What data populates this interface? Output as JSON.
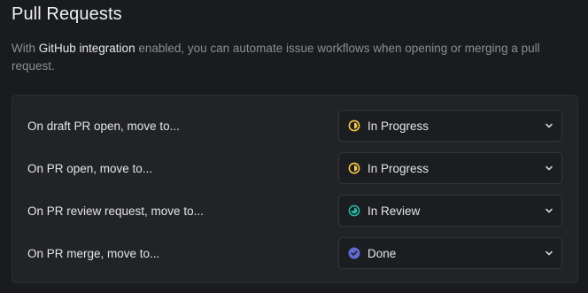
{
  "header": {
    "title": "Pull Requests",
    "desc_prefix": "With ",
    "desc_link": "GitHub integration",
    "desc_suffix": " enabled, you can automate issue workflows when opening or merging a pull request."
  },
  "rows": [
    {
      "label": "On draft PR open, move to...",
      "value": "In Progress",
      "icon": "in-progress-icon",
      "color": "#f2c94c"
    },
    {
      "label": "On PR open, move to...",
      "value": "In Progress",
      "icon": "in-progress-icon",
      "color": "#f2c94c"
    },
    {
      "label": "On PR review request, move to...",
      "value": "In Review",
      "icon": "in-review-icon",
      "color": "#26b5a0"
    },
    {
      "label": "On PR merge, move to...",
      "value": "Done",
      "icon": "done-icon",
      "color": "#5e6ad2"
    }
  ],
  "chevron_icon": "chevron-down-icon"
}
